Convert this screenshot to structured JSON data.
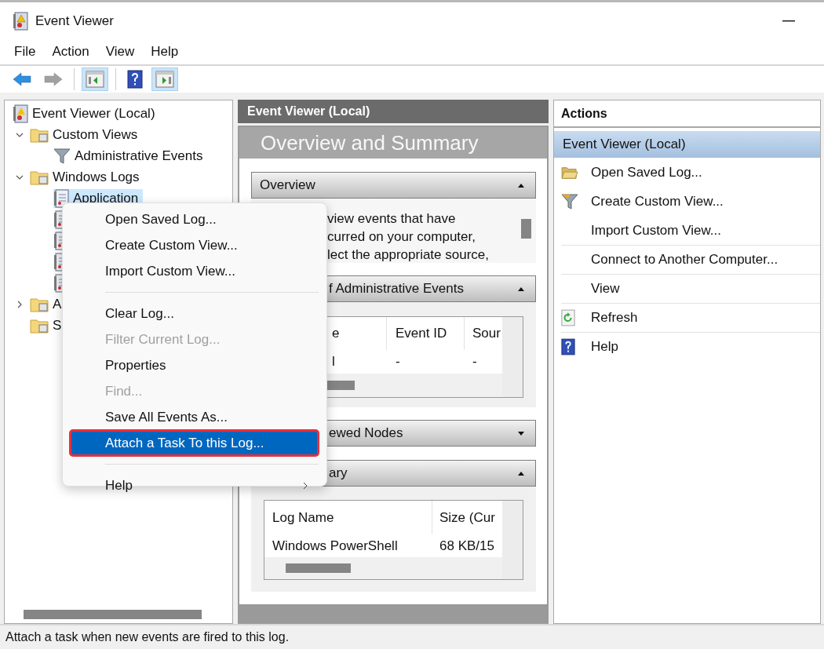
{
  "window": {
    "title": "Event Viewer"
  },
  "menu_bar": [
    "File",
    "Action",
    "View",
    "Help"
  ],
  "toolbar": [
    {
      "kind": "back",
      "disabled": false,
      "on": false
    },
    {
      "kind": "forward",
      "disabled": true,
      "on": false
    },
    {
      "kind": "tree_toggle",
      "disabled": false,
      "on": true
    },
    {
      "kind": "help",
      "disabled": false,
      "on": false
    },
    {
      "kind": "action_toggle",
      "disabled": false,
      "on": true
    }
  ],
  "tree": [
    {
      "label": "Event Viewer (Local)",
      "selected": false,
      "children": [
        {
          "label": "Custom Views",
          "expanded": true,
          "selected": false,
          "children": [
            {
              "label": "Administrative Events",
              "selected": false
            }
          ]
        },
        {
          "label": "Windows Logs",
          "expanded": true,
          "selected": false,
          "children": [
            {
              "label": "Application",
              "selected": true
            },
            {
              "selected": false
            },
            {
              "selected": false
            },
            {
              "selected": false
            },
            {
              "selected": false
            }
          ]
        },
        {
          "label": "A",
          "expanded": false,
          "selected": false
        },
        {
          "label": "S",
          "selected": false
        }
      ]
    }
  ],
  "context_menu": [
    {
      "kind": "item",
      "label": "Open Saved Log...",
      "disabled": false,
      "selected": false
    },
    {
      "kind": "item",
      "label": "Create Custom View...",
      "disabled": false,
      "selected": false
    },
    {
      "kind": "item",
      "label": "Import Custom View...",
      "disabled": false,
      "selected": false
    },
    {
      "kind": "separator"
    },
    {
      "kind": "item",
      "label": "Clear Log...",
      "disabled": false,
      "selected": false
    },
    {
      "kind": "item",
      "label": "Filter Current Log...",
      "disabled": true,
      "selected": false
    },
    {
      "kind": "item",
      "label": "Properties",
      "disabled": false,
      "selected": false
    },
    {
      "kind": "item",
      "label": "Find...",
      "disabled": true,
      "selected": false
    },
    {
      "kind": "item",
      "label": "Save All Events As...",
      "disabled": false,
      "selected": false
    },
    {
      "kind": "item",
      "label": "Attach a Task To this Log...",
      "disabled": false,
      "selected": true
    },
    {
      "kind": "separator"
    },
    {
      "kind": "item",
      "label": "Help",
      "disabled": false,
      "selected": false,
      "submenu": true
    }
  ],
  "middle_pane": {
    "header": "Event Viewer (Local)",
    "banner": "Overview and Summary",
    "sections": [
      {
        "title": "Overview",
        "expanded": true,
        "lines": [
          "view events that have",
          "curred on your computer,",
          "lect the appropriate source,"
        ]
      },
      {
        "title": "f Administrative Events",
        "expanded": true,
        "table": {
          "columns": [
            "e",
            "Event ID",
            "Sour"
          ],
          "rows": [
            [
              "l",
              "-",
              "-"
            ]
          ]
        }
      },
      {
        "title": "ewed Nodes",
        "expanded": false
      },
      {
        "title": "ary",
        "expanded": true,
        "table": {
          "columns": [
            "Log Name",
            "Size (Cur"
          ],
          "rows": [
            [
              "Windows PowerShell",
              "68 KB/15"
            ]
          ]
        }
      }
    ]
  },
  "actions_pane": {
    "title": "Actions",
    "group": {
      "label": "Event Viewer (Local)",
      "selected": true
    },
    "items": [
      "Open Saved Log...",
      "Create Custom View...",
      "Import Custom View...",
      "Connect to Another Computer...",
      "View",
      "Refresh",
      "Help"
    ]
  },
  "status_bar": "Attach a task when new events are fired to this log."
}
